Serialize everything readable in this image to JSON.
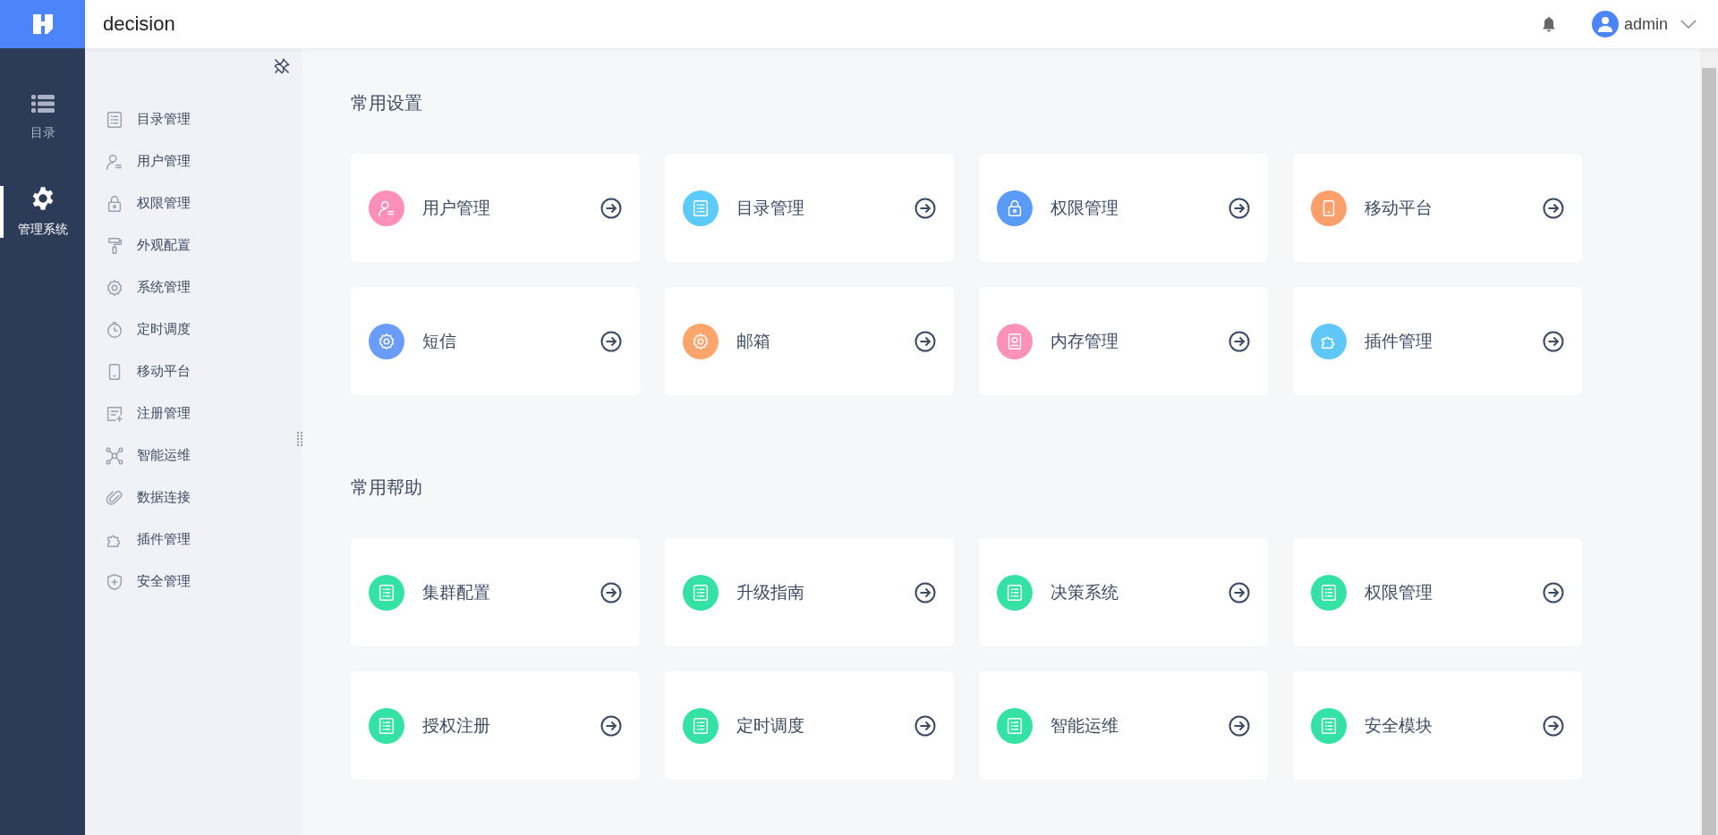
{
  "header": {
    "title": "decision",
    "user": "admin"
  },
  "rail": [
    {
      "label": "目录",
      "kind": "list",
      "selected": false
    },
    {
      "label": "管理系统",
      "kind": "gear",
      "selected": true
    }
  ],
  "sidebar": {
    "items": [
      {
        "label": "目录管理",
        "kind": "list"
      },
      {
        "label": "用户管理",
        "kind": "user"
      },
      {
        "label": "权限管理",
        "kind": "lock"
      },
      {
        "label": "外观配置",
        "kind": "roller"
      },
      {
        "label": "系统管理",
        "kind": "gear"
      },
      {
        "label": "定时调度",
        "kind": "timer"
      },
      {
        "label": "移动平台",
        "kind": "mobile"
      },
      {
        "label": "注册管理",
        "kind": "register"
      },
      {
        "label": "智能运维",
        "kind": "nodes"
      },
      {
        "label": "数据连接",
        "kind": "clip"
      },
      {
        "label": "插件管理",
        "kind": "puzzle"
      },
      {
        "label": "安全管理",
        "kind": "shield"
      }
    ]
  },
  "sections": [
    {
      "title": "常用设置",
      "cards": [
        {
          "label": "用户管理",
          "kind": "user",
          "color": "#fd8fb9"
        },
        {
          "label": "目录管理",
          "kind": "list",
          "color": "#5ccbfa"
        },
        {
          "label": "权限管理",
          "kind": "lock",
          "color": "#5b9bf8"
        },
        {
          "label": "移动平台",
          "kind": "mobile",
          "color": "#fd9f6a"
        },
        {
          "label": "短信",
          "kind": "gear",
          "color": "#6a9cfb"
        },
        {
          "label": "邮箱",
          "kind": "gear",
          "color": "#fea46d"
        },
        {
          "label": "内存管理",
          "kind": "disk",
          "color": "#fc92b7"
        },
        {
          "label": "插件管理",
          "kind": "puzzle",
          "color": "#5fc8f8"
        }
      ]
    },
    {
      "title": "常用帮助",
      "cards": [
        {
          "label": "集群配置",
          "kind": "list",
          "color": "#34e2a6"
        },
        {
          "label": "升级指南",
          "kind": "list",
          "color": "#34e2a6"
        },
        {
          "label": "决策系统",
          "kind": "list",
          "color": "#34e2a6"
        },
        {
          "label": "权限管理",
          "kind": "list",
          "color": "#34e2a6"
        },
        {
          "label": "授权注册",
          "kind": "list",
          "color": "#34e2a6"
        },
        {
          "label": "定时调度",
          "kind": "list",
          "color": "#34e2a6"
        },
        {
          "label": "智能运维",
          "kind": "list",
          "color": "#34e2a6"
        },
        {
          "label": "安全模块",
          "kind": "list",
          "color": "#34e2a6"
        }
      ]
    }
  ]
}
